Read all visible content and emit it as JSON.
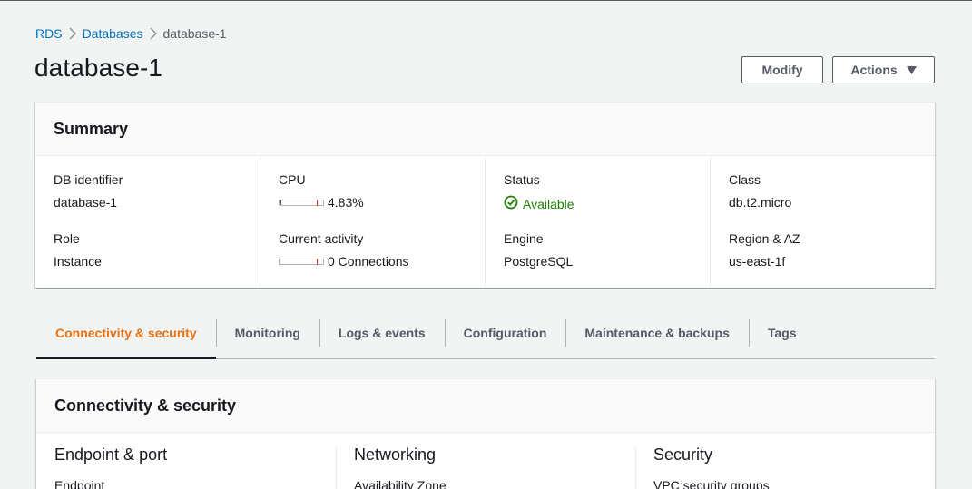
{
  "breadcrumb": {
    "items": [
      "RDS",
      "Databases"
    ],
    "current": "database-1"
  },
  "page": {
    "title": "database-1",
    "modify_label": "Modify",
    "actions_label": "Actions"
  },
  "summary": {
    "title": "Summary",
    "db_identifier_label": "DB identifier",
    "db_identifier_value": "database-1",
    "role_label": "Role",
    "role_value": "Instance",
    "cpu_label": "CPU",
    "cpu_value": "4.83%",
    "cpu_fraction": 0.0483,
    "activity_label": "Current activity",
    "activity_value": "0 Connections",
    "activity_fraction": 0,
    "status_label": "Status",
    "status_value": "Available",
    "engine_label": "Engine",
    "engine_value": "PostgreSQL",
    "class_label": "Class",
    "class_value": "db.t2.micro",
    "region_label": "Region & AZ",
    "region_value": "us-east-1f"
  },
  "tabs": [
    {
      "label": "Connectivity & security",
      "active": true
    },
    {
      "label": "Monitoring",
      "active": false
    },
    {
      "label": "Logs & events",
      "active": false
    },
    {
      "label": "Configuration",
      "active": false
    },
    {
      "label": "Maintenance & backups",
      "active": false
    },
    {
      "label": "Tags",
      "active": false
    }
  ],
  "connectivity": {
    "title": "Connectivity & security",
    "columns": [
      {
        "heading": "Endpoint & port",
        "sub": "Endpoint"
      },
      {
        "heading": "Networking",
        "sub": "Availability Zone"
      },
      {
        "heading": "Security",
        "sub": "VPC security groups"
      }
    ]
  },
  "colors": {
    "link": "#0073bb",
    "active_tab": "#ec7211",
    "status_ok": "#1d8102"
  }
}
